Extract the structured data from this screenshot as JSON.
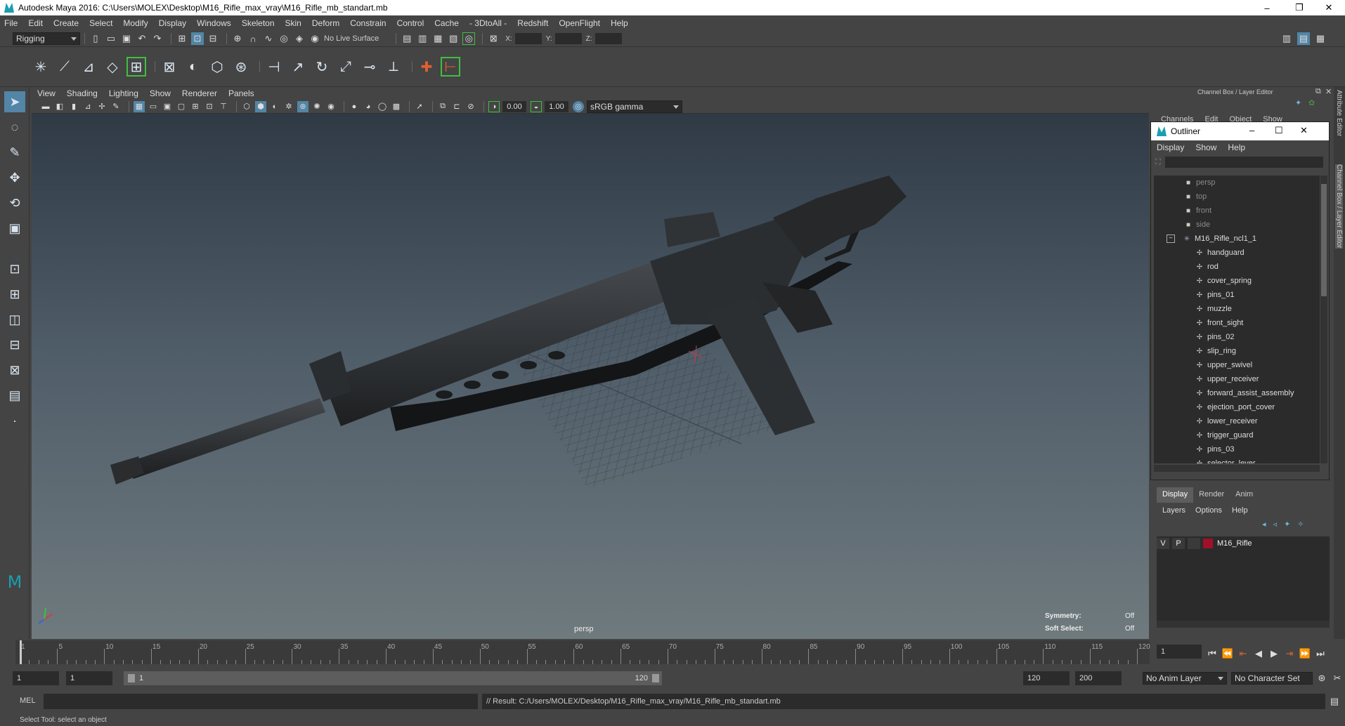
{
  "window": {
    "title": "Autodesk Maya 2016: C:\\Users\\MOLEX\\Desktop\\M16_Rifle_max_vray\\M16_Rifle_mb_standart.mb",
    "minimize": "–",
    "maximize": "❐",
    "close": "✕"
  },
  "menubar": [
    "File",
    "Edit",
    "Create",
    "Select",
    "Modify",
    "Display",
    "Windows",
    "Skeleton",
    "Skin",
    "Deform",
    "Constrain",
    "Control",
    "Cache",
    "- 3DtoAll -",
    "Redshift",
    "OpenFlight",
    "Help"
  ],
  "statusline": {
    "menuset": "Rigging",
    "live_surface": "No Live Surface",
    "x_label": "X:",
    "y_label": "Y:",
    "z_label": "Z:"
  },
  "viewport": {
    "menus": [
      "View",
      "Shading",
      "Lighting",
      "Show",
      "Renderer",
      "Panels"
    ],
    "exposure": "0.00",
    "gamma": "1.00",
    "color_space": "sRGB gamma",
    "camera_label": "persp",
    "symmetry_label": "Symmetry:",
    "symmetry_value": "Off",
    "soft_select_label": "Soft Select:",
    "soft_select_value": "Off"
  },
  "channel_box": {
    "title": "Channel Box / Layer Editor",
    "menus": [
      "Channels",
      "Edit",
      "Object",
      "Show"
    ]
  },
  "outliner": {
    "title": "Outliner",
    "menus": [
      "Display",
      "Show",
      "Help"
    ],
    "cameras": [
      "persp",
      "top",
      "front",
      "side"
    ],
    "group": "M16_Rifle_ncl1_1",
    "children": [
      "handguard",
      "rod",
      "cover_spring",
      "pins_01",
      "muzzle",
      "front_sight",
      "pins_02",
      "slip_ring",
      "upper_swivel",
      "upper_receiver",
      "forward_assist_assembly",
      "ejection_port_cover",
      "lower_receiver",
      "trigger_guard",
      "pins_03",
      "selector_lever"
    ]
  },
  "layers": {
    "tabs": [
      "Display",
      "Render",
      "Anim"
    ],
    "menus": [
      "Layers",
      "Options",
      "Help"
    ],
    "row": {
      "visible": "V",
      "playback": "P",
      "name": "M16_Rifle",
      "color": "#a0102a"
    }
  },
  "side_tabs": [
    "Attribute Editor",
    "Channel Box / Layer Editor"
  ],
  "timeline": {
    "ticks": [
      "1",
      "5",
      "10",
      "15",
      "20",
      "25",
      "30",
      "35",
      "40",
      "45",
      "50",
      "55",
      "60",
      "65",
      "70",
      "75",
      "80",
      "85",
      "90",
      "95",
      "100",
      "105",
      "110",
      "115",
      "120"
    ],
    "current_frame": "1"
  },
  "range": {
    "start": "1",
    "playback_start": "1",
    "slider_start": "1",
    "slider_end": "120",
    "playback_end": "120",
    "end": "200",
    "anim_layer": "No Anim Layer",
    "character_set": "No Character Set"
  },
  "command": {
    "label": "MEL",
    "result": "// Result: C:/Users/MOLEX/Desktop/M16_Rifle_max_vray/M16_Rifle_mb_standart.mb"
  },
  "help_line": "Select Tool: select an object"
}
